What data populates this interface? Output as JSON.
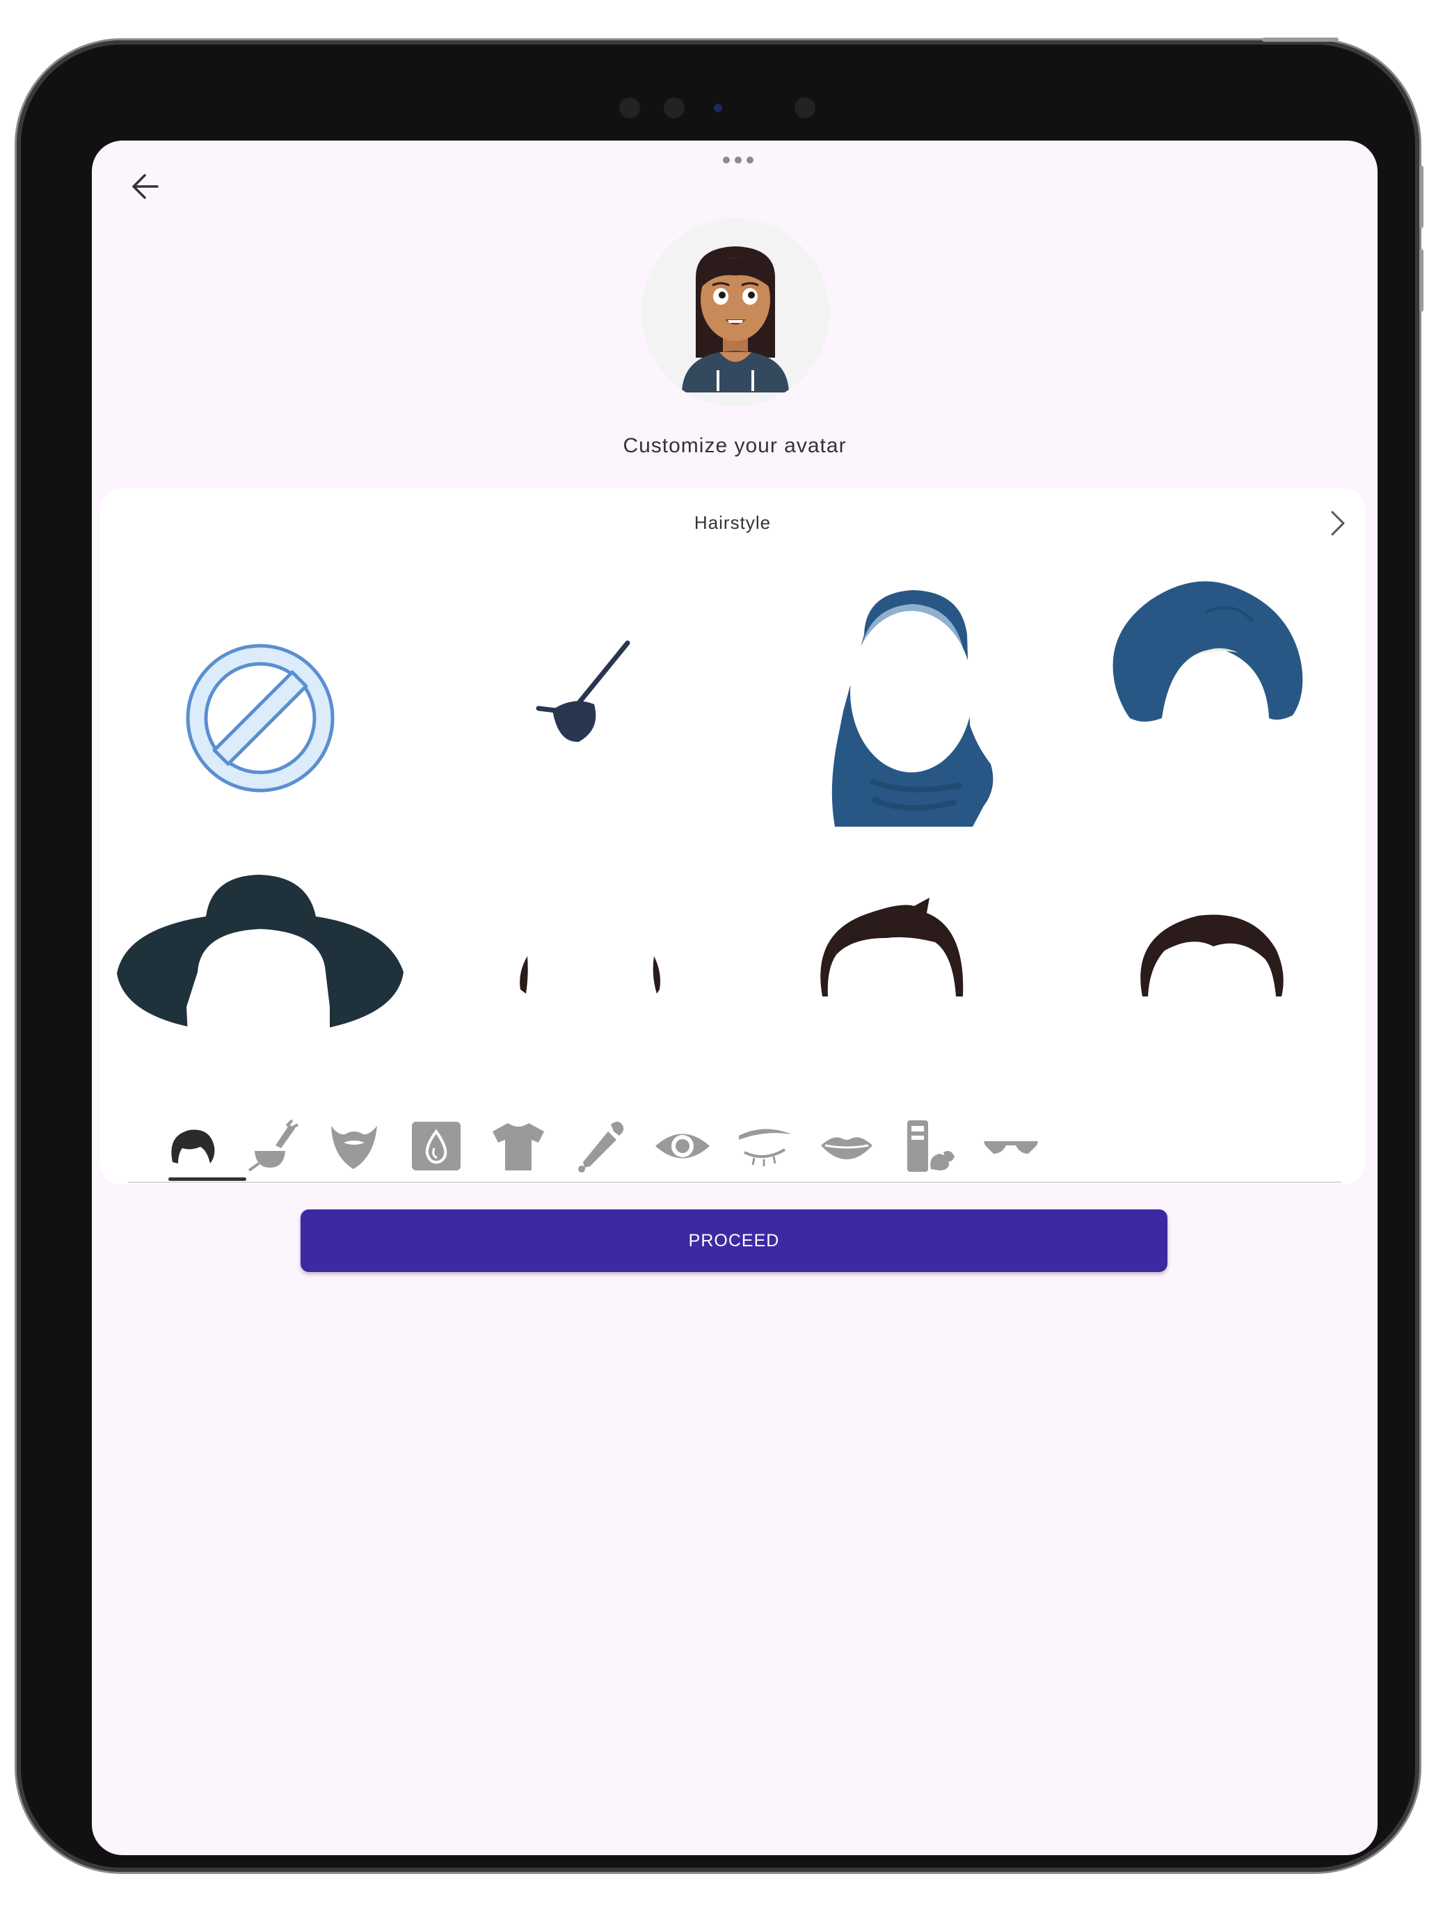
{
  "header": {
    "back_icon": "arrow-left-icon",
    "more_icon": "three-dots-icon"
  },
  "avatar": {
    "skin_color": "#c98a59",
    "hair_color": "#2b1b1b",
    "hoodie_color": "#34495e"
  },
  "subtitle": "Customize your avatar",
  "panel": {
    "title": "Hairstyle",
    "next_icon": "chevron-right-icon",
    "options": [
      {
        "name": "none",
        "icon": "no-selection-icon"
      },
      {
        "name": "eyepatch",
        "icon": "eyepatch-icon"
      },
      {
        "name": "hijab",
        "icon": "hijab-icon"
      },
      {
        "name": "turban",
        "icon": "turban-icon"
      },
      {
        "name": "hat",
        "icon": "wide-hat-icon"
      },
      {
        "name": "sideburns",
        "icon": "sideburns-icon"
      },
      {
        "name": "short-spiky",
        "icon": "short-spiky-hair-icon"
      },
      {
        "name": "short-side-part",
        "icon": "side-part-hair-icon"
      }
    ],
    "tabs": [
      {
        "id": "hairstyle",
        "icon": "hairstyle-icon",
        "selected": true
      },
      {
        "id": "hair-dye",
        "icon": "hair-dye-icon",
        "selected": false
      },
      {
        "id": "beard",
        "icon": "beard-icon",
        "selected": false
      },
      {
        "id": "skin",
        "icon": "skin-tone-icon",
        "selected": false
      },
      {
        "id": "clothes",
        "icon": "tshirt-icon",
        "selected": false
      },
      {
        "id": "color-picker",
        "icon": "eyedropper-icon",
        "selected": false
      },
      {
        "id": "eyes",
        "icon": "eye-icon",
        "selected": false
      },
      {
        "id": "eyebrows",
        "icon": "eyebrow-icon",
        "selected": false
      },
      {
        "id": "mouth",
        "icon": "lips-icon",
        "selected": false
      },
      {
        "id": "makeup",
        "icon": "makeup-icon",
        "selected": false
      },
      {
        "id": "glasses",
        "icon": "sunglasses-icon",
        "selected": false
      }
    ],
    "colors": {
      "hijab": "#285785",
      "hat": "#1f313b",
      "hair": "#2b1b1b",
      "tab_icon": "#9a9a9a",
      "none_ring": "#5a8fd0",
      "none_fill": "#dcecfb"
    }
  },
  "proceed_label": "PROCEED",
  "proceed_color": "#3d2aa2"
}
